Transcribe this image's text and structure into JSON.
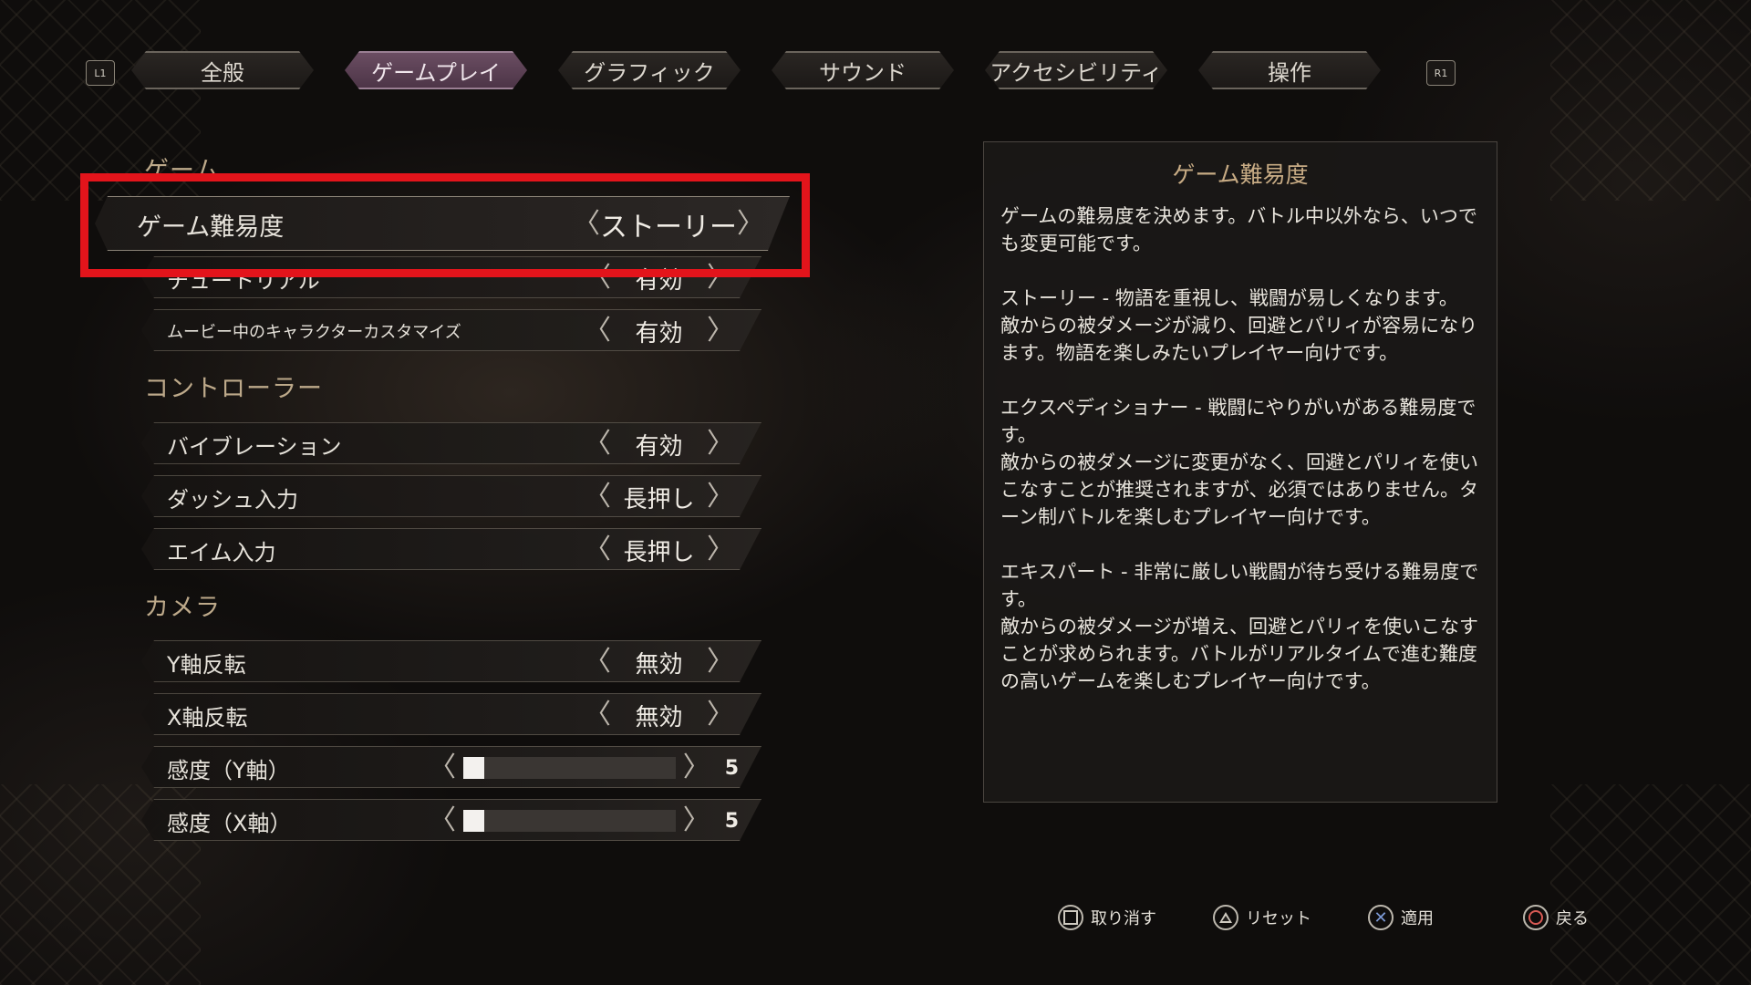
{
  "tabs": {
    "left_shoulder": "L1",
    "right_shoulder": "R1",
    "items": [
      "全般",
      "ゲームプレイ",
      "グラフィック",
      "サウンド",
      "アクセシビリティ",
      "操作"
    ],
    "active_index": 1
  },
  "sections": {
    "game": "ゲーム",
    "controller": "コントローラー",
    "camera": "カメラ"
  },
  "settings": {
    "difficulty": {
      "label": "ゲーム難易度",
      "value": "ストーリー"
    },
    "tutorial": {
      "label": "チュートリアル",
      "value": "有効"
    },
    "movie_customize": {
      "label": "ムービー中のキャラクターカスタマイズ",
      "value": "有効"
    },
    "vibration": {
      "label": "バイブレーション",
      "value": "有効"
    },
    "dash_input": {
      "label": "ダッシュ入力",
      "value": "長押し"
    },
    "aim_input": {
      "label": "エイム入力",
      "value": "長押し"
    },
    "invert_y": {
      "label": "Y軸反転",
      "value": "無効"
    },
    "invert_x": {
      "label": "X軸反転",
      "value": "無効"
    },
    "sens_y": {
      "label": "感度（Y軸）",
      "value": "5",
      "fraction": 0.1
    },
    "sens_x": {
      "label": "感度（X軸）",
      "value": "5",
      "fraction": 0.1
    }
  },
  "description": {
    "title": "ゲーム難易度",
    "paragraphs": [
      "ゲームの難易度を決めます。バトル中以外なら、いつでも変更可能です。",
      "ストーリー - 物語を重視し、戦闘が易しくなります。\n敵からの被ダメージが減り、回避とパリィが容易になります。物語を楽しみたいプレイヤー向けです。",
      "エクスペディショナー - 戦闘にやりがいがある難易度です。\n敵からの被ダメージに変更がなく、回避とパリィを使いこなすことが推奨されますが、必須ではありません。ターン制バトルを楽しむプレイヤー向けです。",
      "エキスパート - 非常に厳しい戦闘が待ち受ける難易度です。\n敵からの被ダメージが増え、回避とパリィを使いこなすことが求められます。バトルがリアルタイムで進む難度の高いゲームを楽しむプレイヤー向けです。"
    ]
  },
  "footer": {
    "cancel": "取り消す",
    "reset": "リセット",
    "apply": "適用",
    "back": "戻る"
  },
  "colors": {
    "highlight": "#e3141b",
    "active_tab": "#5a3f53",
    "section_title": "#bda98a"
  }
}
